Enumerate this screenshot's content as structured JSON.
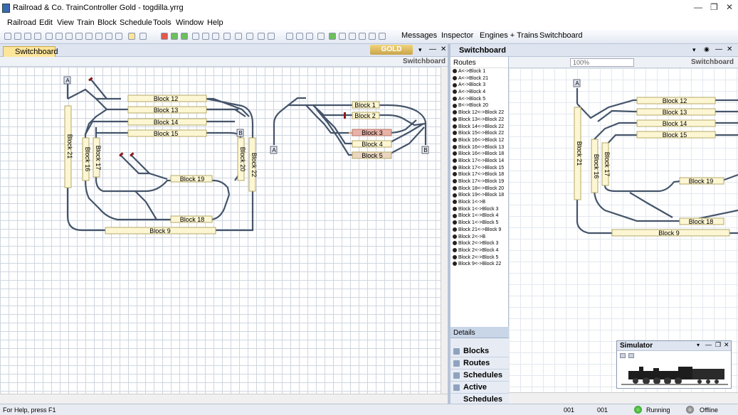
{
  "app": {
    "title": "Railroad & Co. TrainController Gold - togdilla.yrrg"
  },
  "menu": [
    "Railroad",
    "Edit",
    "View",
    "Train",
    "Block",
    "Schedule",
    "Tools",
    "Window",
    "Help"
  ],
  "toolbar_right": [
    "Messages",
    "Inspector",
    "Engines + Trains",
    "Switchboard"
  ],
  "left": {
    "tab": "Switchboard",
    "badge": "GOLD",
    "header": "Switchboard"
  },
  "right": {
    "title": "Switchboard",
    "zoom": "100%",
    "header": "Switchboard"
  },
  "routes": {
    "header": "Routes",
    "items": [
      "A<->Block 1",
      "A<->Block 21",
      "A<->Block 3",
      "A<->Block 4",
      "A<->Block 5",
      "B<->Block 20",
      "Block 12<->Block 22",
      "Block 13<->Block 22",
      "Block 14<->Block 22",
      "Block 15<->Block 22",
      "Block 16<->Block 12",
      "Block 16<->Block 13",
      "Block 16<->Block 18",
      "Block 17<->Block 14",
      "Block 17<->Block 15",
      "Block 17<->Block 18",
      "Block 17<->Block 19",
      "Block 18<->Block 20",
      "Block 19<->Block 18",
      "Block 1<->B",
      "Block 1<->Block 3",
      "Block 1<->Block 4",
      "Block 1<->Block 5",
      "Block 21<->Block 9",
      "Block 2<->B",
      "Block 2<->Block 3",
      "Block 2<->Block 4",
      "Block 2<->Block 5",
      "Block 9<->Block 22"
    ]
  },
  "details": {
    "header": "Details",
    "nav": [
      "Blocks",
      "Routes",
      "Schedules",
      "Active Schedules"
    ]
  },
  "simulator": {
    "title": "Simulator"
  },
  "status": {
    "help": "For Help, press F1",
    "c1": "001",
    "c2": "001",
    "running": "Running",
    "offline": "Offline"
  },
  "blocks_left": {
    "b12": "Block 12",
    "b13": "Block 13",
    "b14": "Block 14",
    "b15": "Block 15",
    "b19": "Block 19",
    "b18": "Block 18",
    "b9": "Block 9",
    "b21": "Block 21",
    "b16": "Block 16",
    "b17": "Block 17",
    "b20": "Block 20",
    "b22": "Block 22",
    "b1": "Block 1",
    "b2": "Block 2",
    "b3": "Block 3",
    "b4": "Block 4",
    "b5": "Block 5",
    "a": "A",
    "b": "B"
  },
  "colors": {
    "track": "#44546a",
    "block": "#fdf6d3",
    "occupied": "#e9b2a8",
    "accent": "#fde59a"
  }
}
